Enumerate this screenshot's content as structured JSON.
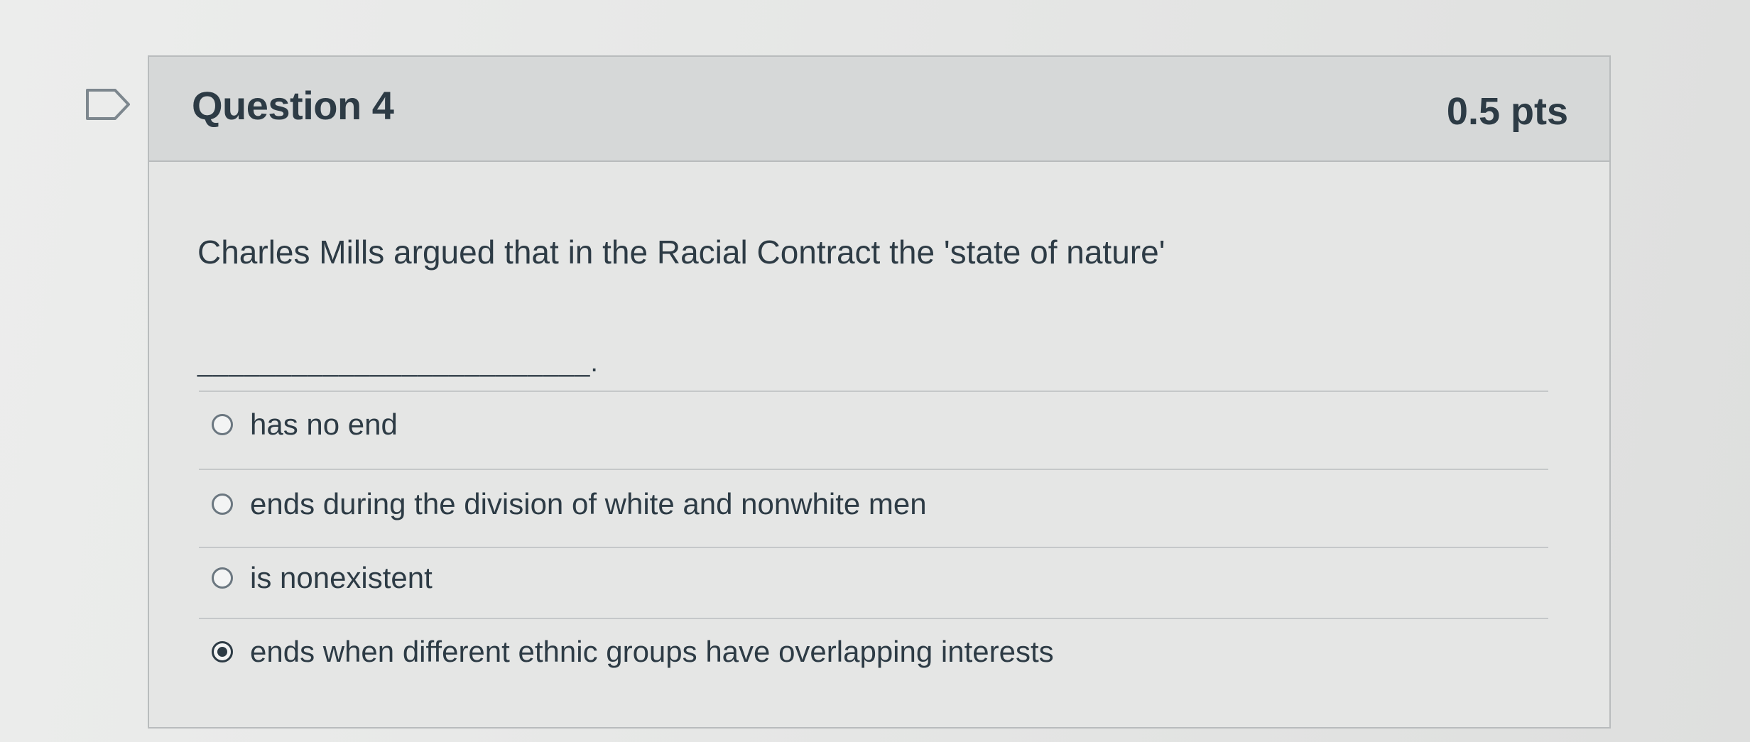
{
  "question": {
    "title": "Question 4",
    "points": "0.5 pts",
    "text": "Charles Mills argued that in the Racial Contract the 'state of nature'",
    "blank": "_________________________."
  },
  "answers": [
    {
      "label": "has no end",
      "selected": false
    },
    {
      "label": "ends during the division of white and nonwhite men",
      "selected": false
    },
    {
      "label": "is nonexistent",
      "selected": false
    },
    {
      "label": "ends when different ethnic groups have overlapping interests",
      "selected": true
    }
  ],
  "icons": {
    "flag": "flag-question-icon"
  },
  "colors": {
    "text": "#2d3b45",
    "header_bg": "#d6d8d8",
    "border": "#b9bcbd"
  }
}
